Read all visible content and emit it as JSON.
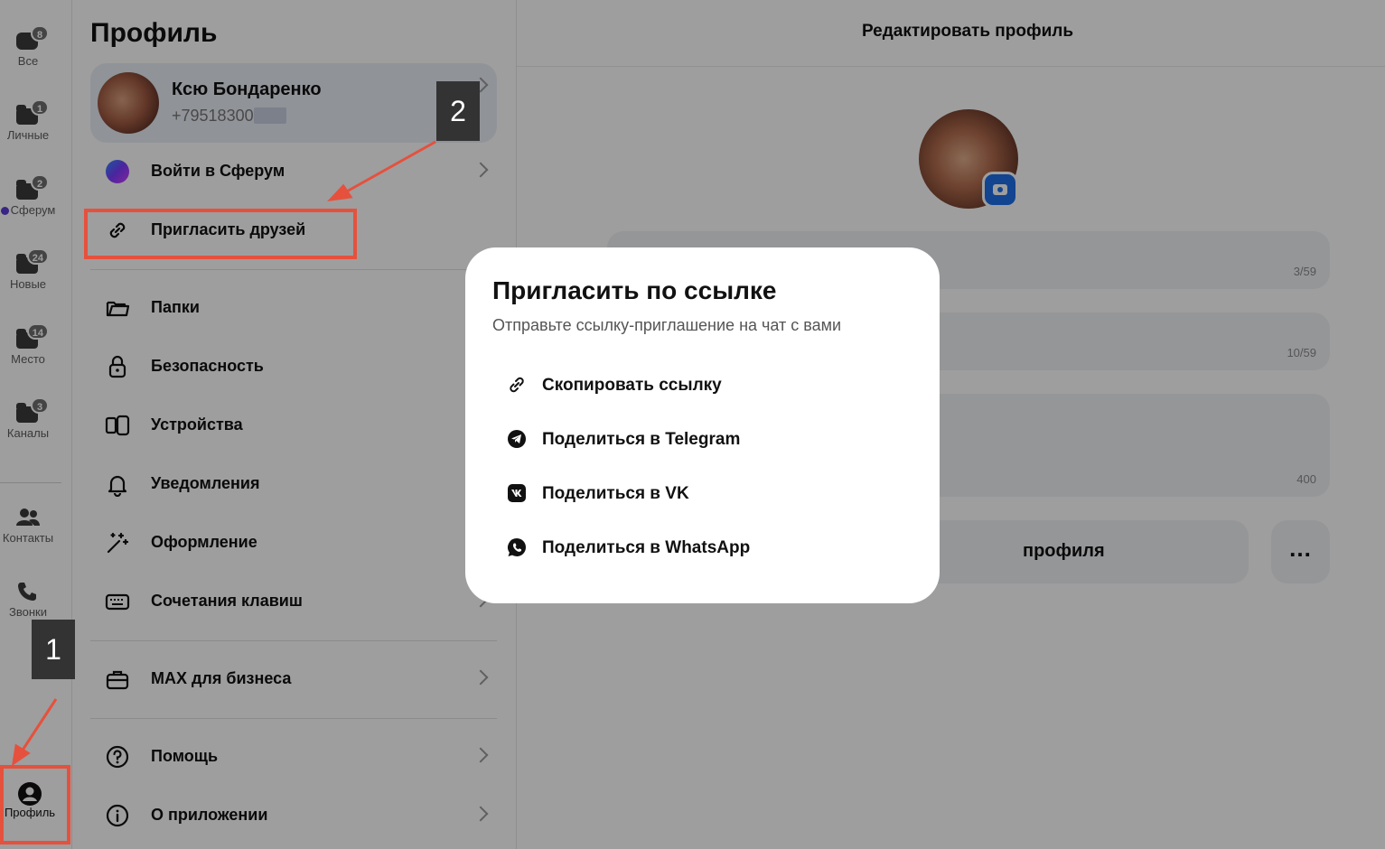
{
  "rail": {
    "items": [
      {
        "label": "Все",
        "badge": "8"
      },
      {
        "label": "Личные",
        "badge": "1"
      },
      {
        "label": "Сферум",
        "badge": "2"
      },
      {
        "label": "Новые",
        "badge": "24"
      },
      {
        "label": "Место",
        "badge": "14"
      },
      {
        "label": "Каналы",
        "badge": "3"
      }
    ],
    "contacts": "Контакты",
    "calls": "Звонки",
    "profile": "Профиль"
  },
  "panel": {
    "title": "Профиль",
    "user": {
      "name": "Ксю Бондаренко",
      "phone": "+79518300"
    },
    "menu": [
      {
        "label": "Войти в Сферум",
        "icon": "sferum-logo-icon"
      },
      {
        "label": "Пригласить друзей",
        "icon": "link-icon"
      },
      {
        "label": "Папки",
        "icon": "folder-icon"
      },
      {
        "label": "Безопасность",
        "icon": "lock-icon"
      },
      {
        "label": "Устройства",
        "icon": "devices-icon"
      },
      {
        "label": "Уведомления",
        "icon": "bell-icon"
      },
      {
        "label": "Оформление",
        "icon": "magic-wand-icon"
      },
      {
        "label": "Сочетания клавиш",
        "icon": "keyboard-icon"
      },
      {
        "label": "MAX для бизнеса",
        "icon": "briefcase-icon"
      },
      {
        "label": "Помощь",
        "icon": "help-icon"
      },
      {
        "label": "О приложении",
        "icon": "info-icon"
      }
    ]
  },
  "right": {
    "title": "Редактировать профиль",
    "counters": [
      "3/59",
      "10/59",
      "400"
    ],
    "share_label": "профиля",
    "more_label": "..."
  },
  "modal": {
    "title": "Пригласить по ссылке",
    "subtitle": "Отправьте ссылку-приглашение на чат с вами",
    "options": [
      {
        "label": "Скопировать ссылку",
        "icon": "link-icon"
      },
      {
        "label": "Поделиться в Telegram",
        "icon": "telegram-icon"
      },
      {
        "label": "Поделиться в VK",
        "icon": "vk-icon"
      },
      {
        "label": "Поделиться в WhatsApp",
        "icon": "whatsapp-icon"
      }
    ]
  },
  "annotations": {
    "step1": "1",
    "step2": "2"
  },
  "colors": {
    "accent": "#1e6fe8",
    "annotation": "#e5513d",
    "sferum": "#5b3cd6"
  }
}
